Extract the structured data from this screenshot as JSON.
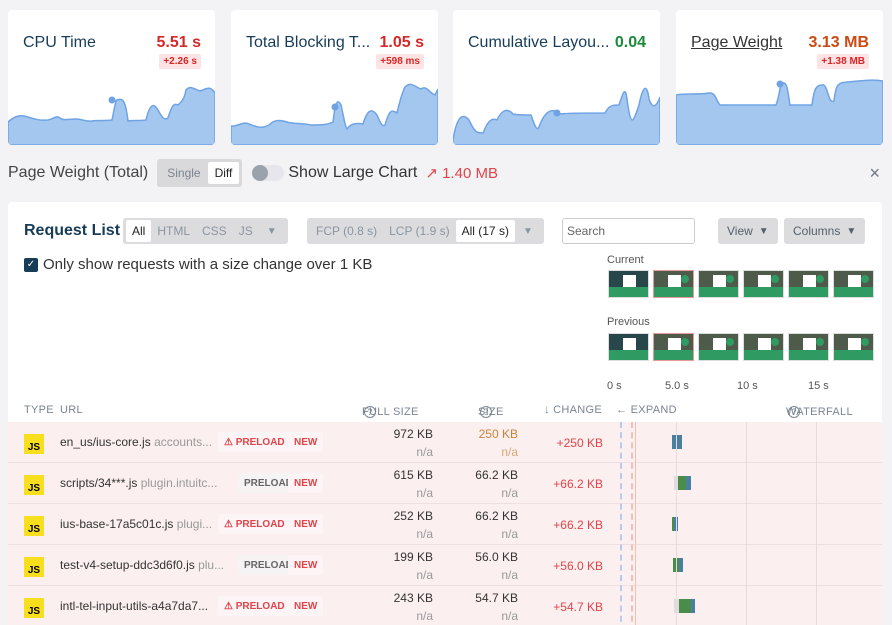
{
  "metrics": [
    {
      "title": "CPU Time",
      "value": "5.51 s",
      "delta": "+2.26 s",
      "value_color": "#d62828",
      "link": false
    },
    {
      "title": "Total Blocking T...",
      "value": "1.05 s",
      "delta": "+598 ms",
      "value_color": "#d62828",
      "link": false
    },
    {
      "title": "Cumulative Layou...",
      "value": "0.04",
      "delta": null,
      "value_color": "#1a8a3a",
      "link": false
    },
    {
      "title": "Page Weight",
      "value": "3.13 MB",
      "delta": "+1.38 MB",
      "value_color": "#cc4a12",
      "link": true
    }
  ],
  "toolbar": {
    "title": "Page Weight (Total)",
    "mode_single": "Single",
    "mode_diff": "Diff",
    "active_mode": "Diff",
    "toggle_label": "Show Large Chart",
    "toggle_on": false,
    "trend_icon": "trend-up-icon",
    "trend_value": "1.40 MB",
    "close_icon": "×"
  },
  "request_list": {
    "title": "Request List",
    "type_filters": [
      "All",
      "HTML",
      "CSS",
      "JS"
    ],
    "type_active": "All",
    "time_filters": [
      "FCP (0.8 s)",
      "LCP (1.9 s)",
      "All (17 s)"
    ],
    "time_active": "All (17 s)",
    "search_placeholder": "Search",
    "view_label": "View",
    "columns_label": "Columns",
    "checkbox_label": "Only show requests with a size change over 1 KB",
    "checkbox_checked": true
  },
  "filmstrip": {
    "current_label": "Current",
    "previous_label": "Previous",
    "tick_labels": [
      "0 s",
      "5.0 s",
      "10 s",
      "15 s"
    ]
  },
  "table": {
    "headers": {
      "type": "TYPE",
      "url": "URL",
      "full_size": "FULL SIZE",
      "size": "SIZE",
      "change": "↓ CHANGE",
      "expand": "← EXPAND",
      "waterfall": "WATERFALL"
    },
    "rows": [
      {
        "type": "JS",
        "file": "en_us/ius-core.js",
        "host": "accounts...",
        "preload": "PRELOAD",
        "preload_warning": true,
        "badge": "NEW",
        "full_size": "972 KB",
        "full_size_prev": "n/a",
        "size": "250 KB",
        "size_prev": "n/a",
        "size_highlight": true,
        "change": "+250 KB"
      },
      {
        "type": "JS",
        "file": "scripts/34***.js",
        "host": "plugin.intuitc...",
        "preload": "PRELOAD",
        "preload_warning": false,
        "badge": "NEW",
        "full_size": "615 KB",
        "full_size_prev": "n/a",
        "size": "66.2 KB",
        "size_prev": "n/a",
        "size_highlight": false,
        "change": "+66.2 KB"
      },
      {
        "type": "JS",
        "file": "ius-base-17a5c01c.js",
        "host": "plugi...",
        "preload": "PRELOAD",
        "preload_warning": true,
        "badge": "NEW",
        "full_size": "252 KB",
        "full_size_prev": "n/a",
        "size": "66.2 KB",
        "size_prev": "n/a",
        "size_highlight": false,
        "change": "+66.2 KB"
      },
      {
        "type": "JS",
        "file": "test-v4-setup-ddc3d6f0.js",
        "host": "plu...",
        "preload": "PRELOAD",
        "preload_warning": false,
        "badge": "NEW",
        "full_size": "199 KB",
        "full_size_prev": "n/a",
        "size": "56.0 KB",
        "size_prev": "n/a",
        "size_highlight": false,
        "change": "+56.0 KB"
      },
      {
        "type": "JS",
        "file": "intl-tel-input-utils-a4a7da7...",
        "host": "",
        "preload": "PRELOAD",
        "preload_warning": true,
        "badge": "NEW",
        "full_size": "243 KB",
        "full_size_prev": "n/a",
        "size": "54.7 KB",
        "size_prev": "n/a",
        "size_highlight": false,
        "change": "+54.7 KB"
      }
    ]
  }
}
